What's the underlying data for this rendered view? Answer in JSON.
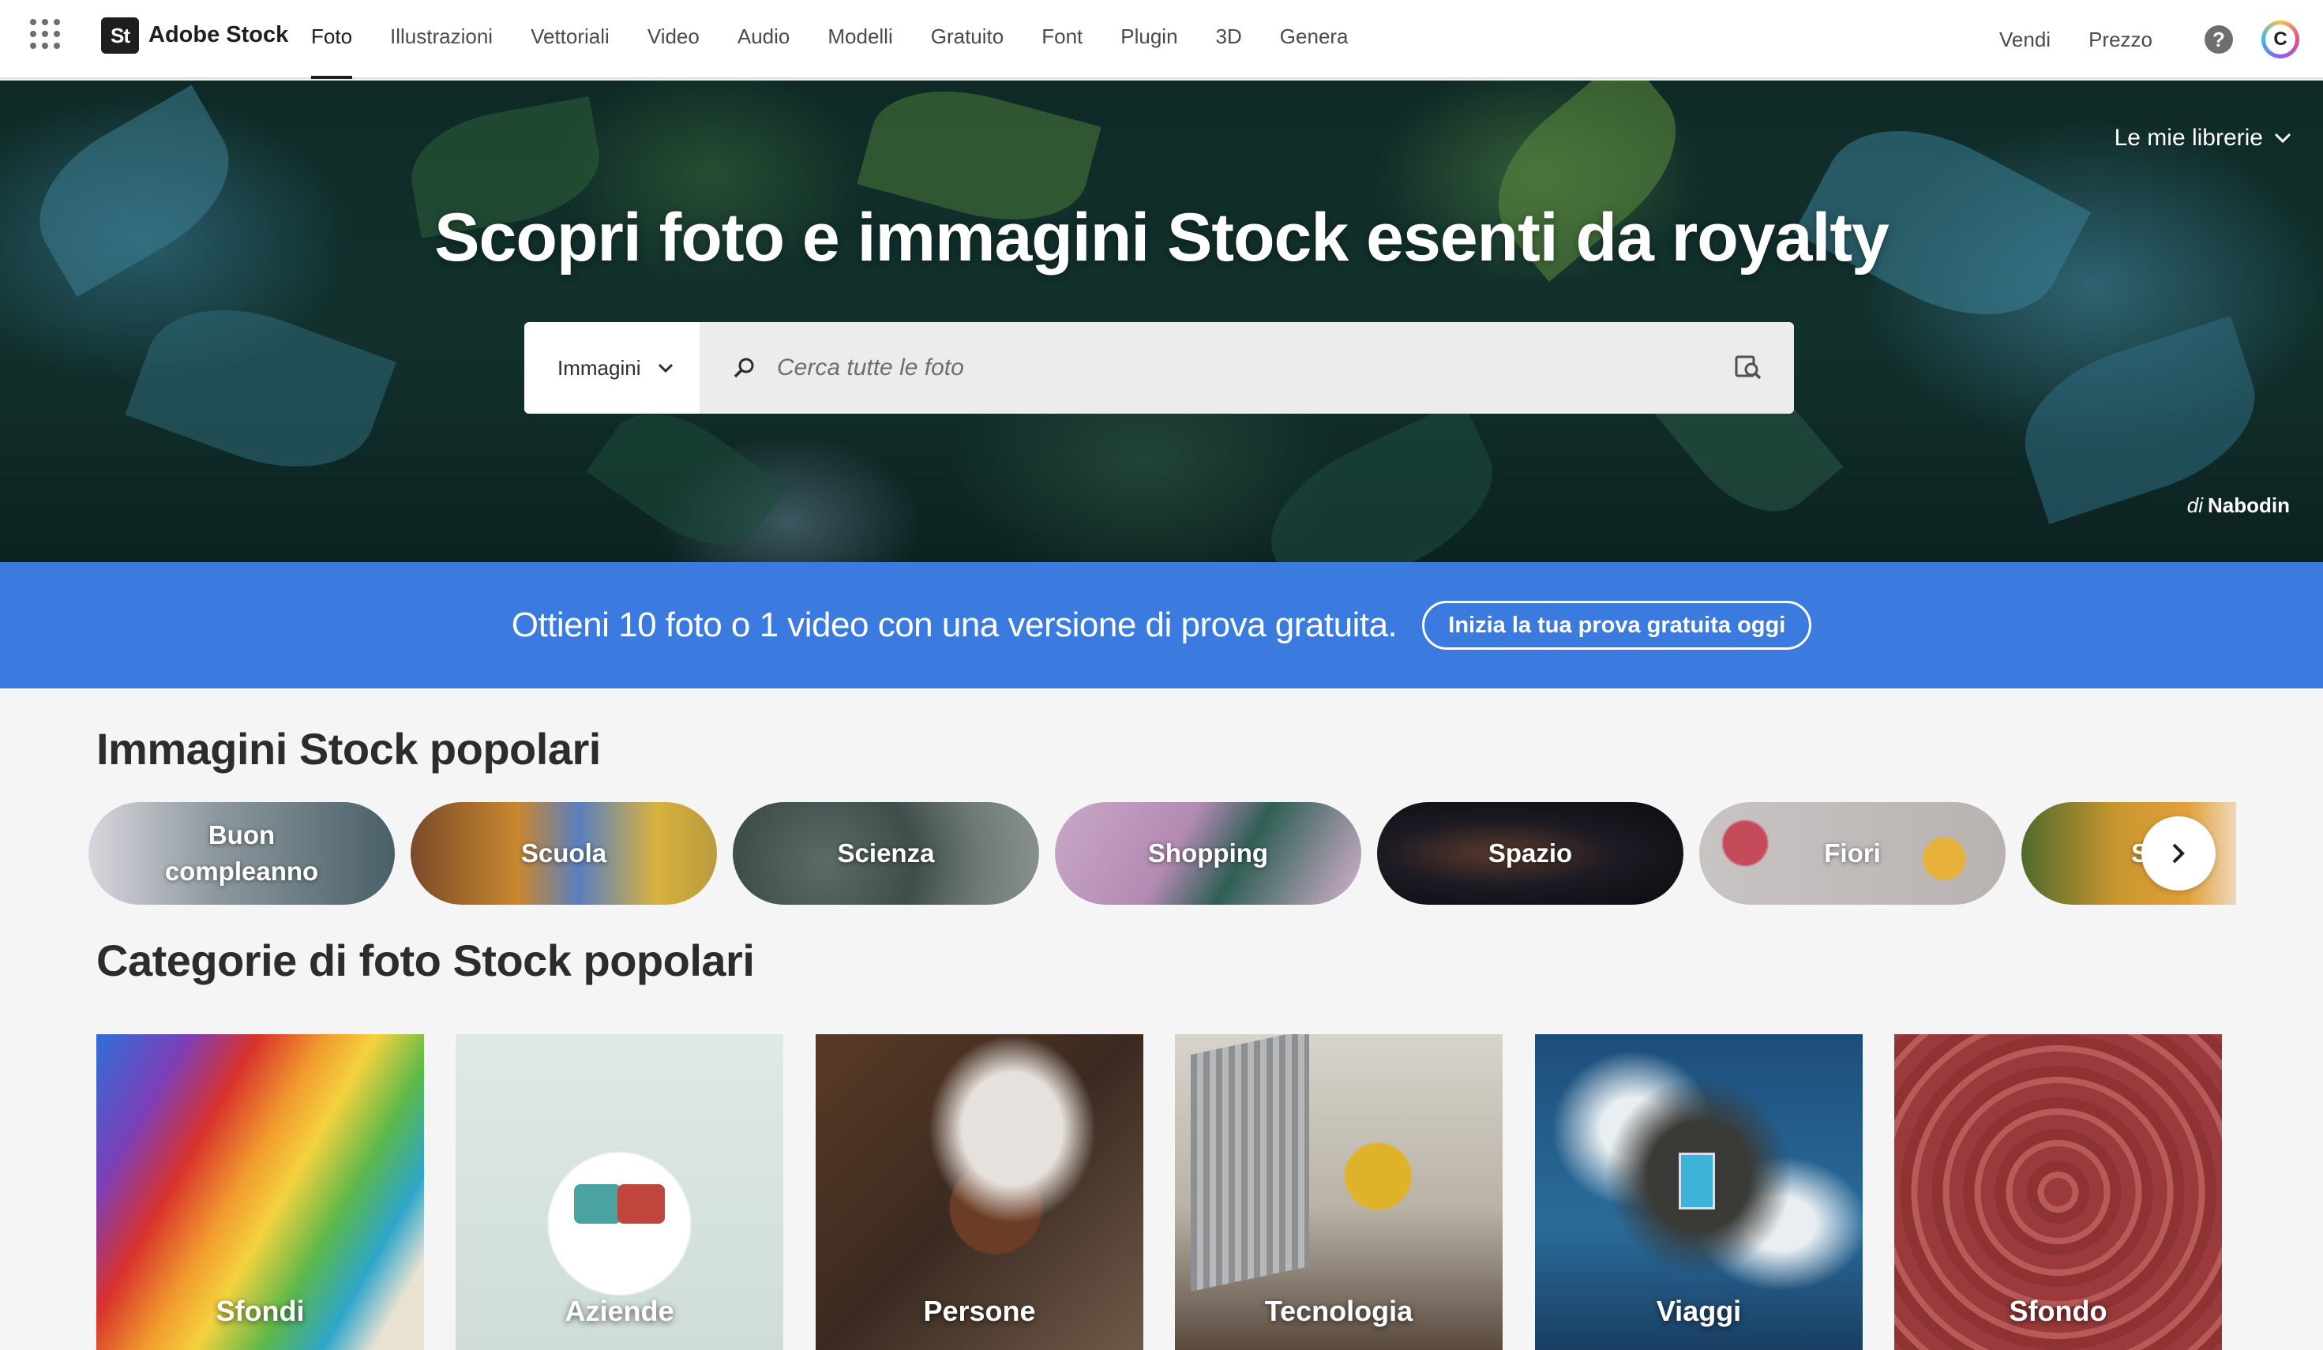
{
  "nav": {
    "brand": "Adobe Stock",
    "brand_mark": "St",
    "links": [
      "Foto",
      "Illustrazioni",
      "Vettoriali",
      "Video",
      "Audio",
      "Modelli",
      "Gratuito",
      "Font",
      "Plugin",
      "3D",
      "Genera"
    ],
    "active": "Foto",
    "sell": "Vendi",
    "pricing": "Prezzo",
    "help_glyph": "?",
    "avatar_initial": "C"
  },
  "hero": {
    "libraries": "Le mie librerie",
    "title": "Scopri foto e immagini Stock esenti da royalty",
    "search_type": "Immagini",
    "search_placeholder": "Cerca tutte le foto",
    "credit_prefix": "di",
    "credit_author": "Nabodin"
  },
  "promo": {
    "text": "Ottieni 10 foto o 1 video con una versione di prova gratuita.",
    "button": "Inizia la tua prova gratuita oggi"
  },
  "popular": {
    "title": "Immagini Stock popolari",
    "items": [
      "Buon compleanno",
      "Scuola",
      "Scienza",
      "Shopping",
      "Spazio",
      "Fiori",
      "S"
    ]
  },
  "categories": {
    "title": "Categorie di foto Stock popolari",
    "items": [
      "Sfondi",
      "Aziende",
      "Persone",
      "Tecnologia",
      "Viaggi",
      "Sfondo"
    ]
  },
  "colors": {
    "promo_bg": "#3b7be0",
    "nav_bg": "#ffffff",
    "page_bg": "#f5f5f5"
  },
  "icons": [
    "apps-grid-icon",
    "search-icon",
    "visual-search-icon",
    "chevron-down-icon",
    "chevron-right-icon",
    "help-icon"
  ]
}
